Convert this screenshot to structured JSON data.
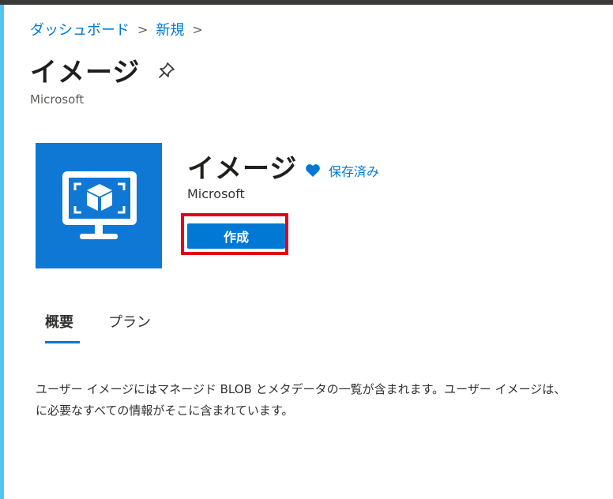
{
  "breadcrumb": {
    "items": [
      "ダッシュボード",
      "新規"
    ],
    "separator": ">"
  },
  "header": {
    "title": "イメージ",
    "subtitle": "Microsoft"
  },
  "product": {
    "title": "イメージ",
    "publisher": "Microsoft",
    "saved_label": "保存済み",
    "create_label": "作成",
    "icon": "monitor-cube-icon"
  },
  "tabs": [
    {
      "label": "概要",
      "selected": true
    },
    {
      "label": "プラン",
      "selected": false
    }
  ],
  "description": {
    "line1": "ユーザー イメージにはマネージド BLOB とメタデータの一覧が含まれます。ユーザー イメージは、",
    "line2": "に必要なすべての情報がそこに含まれています。"
  },
  "colors": {
    "accent": "#0078d4",
    "highlight": "#e3001b",
    "tile": "#0f78d4"
  }
}
